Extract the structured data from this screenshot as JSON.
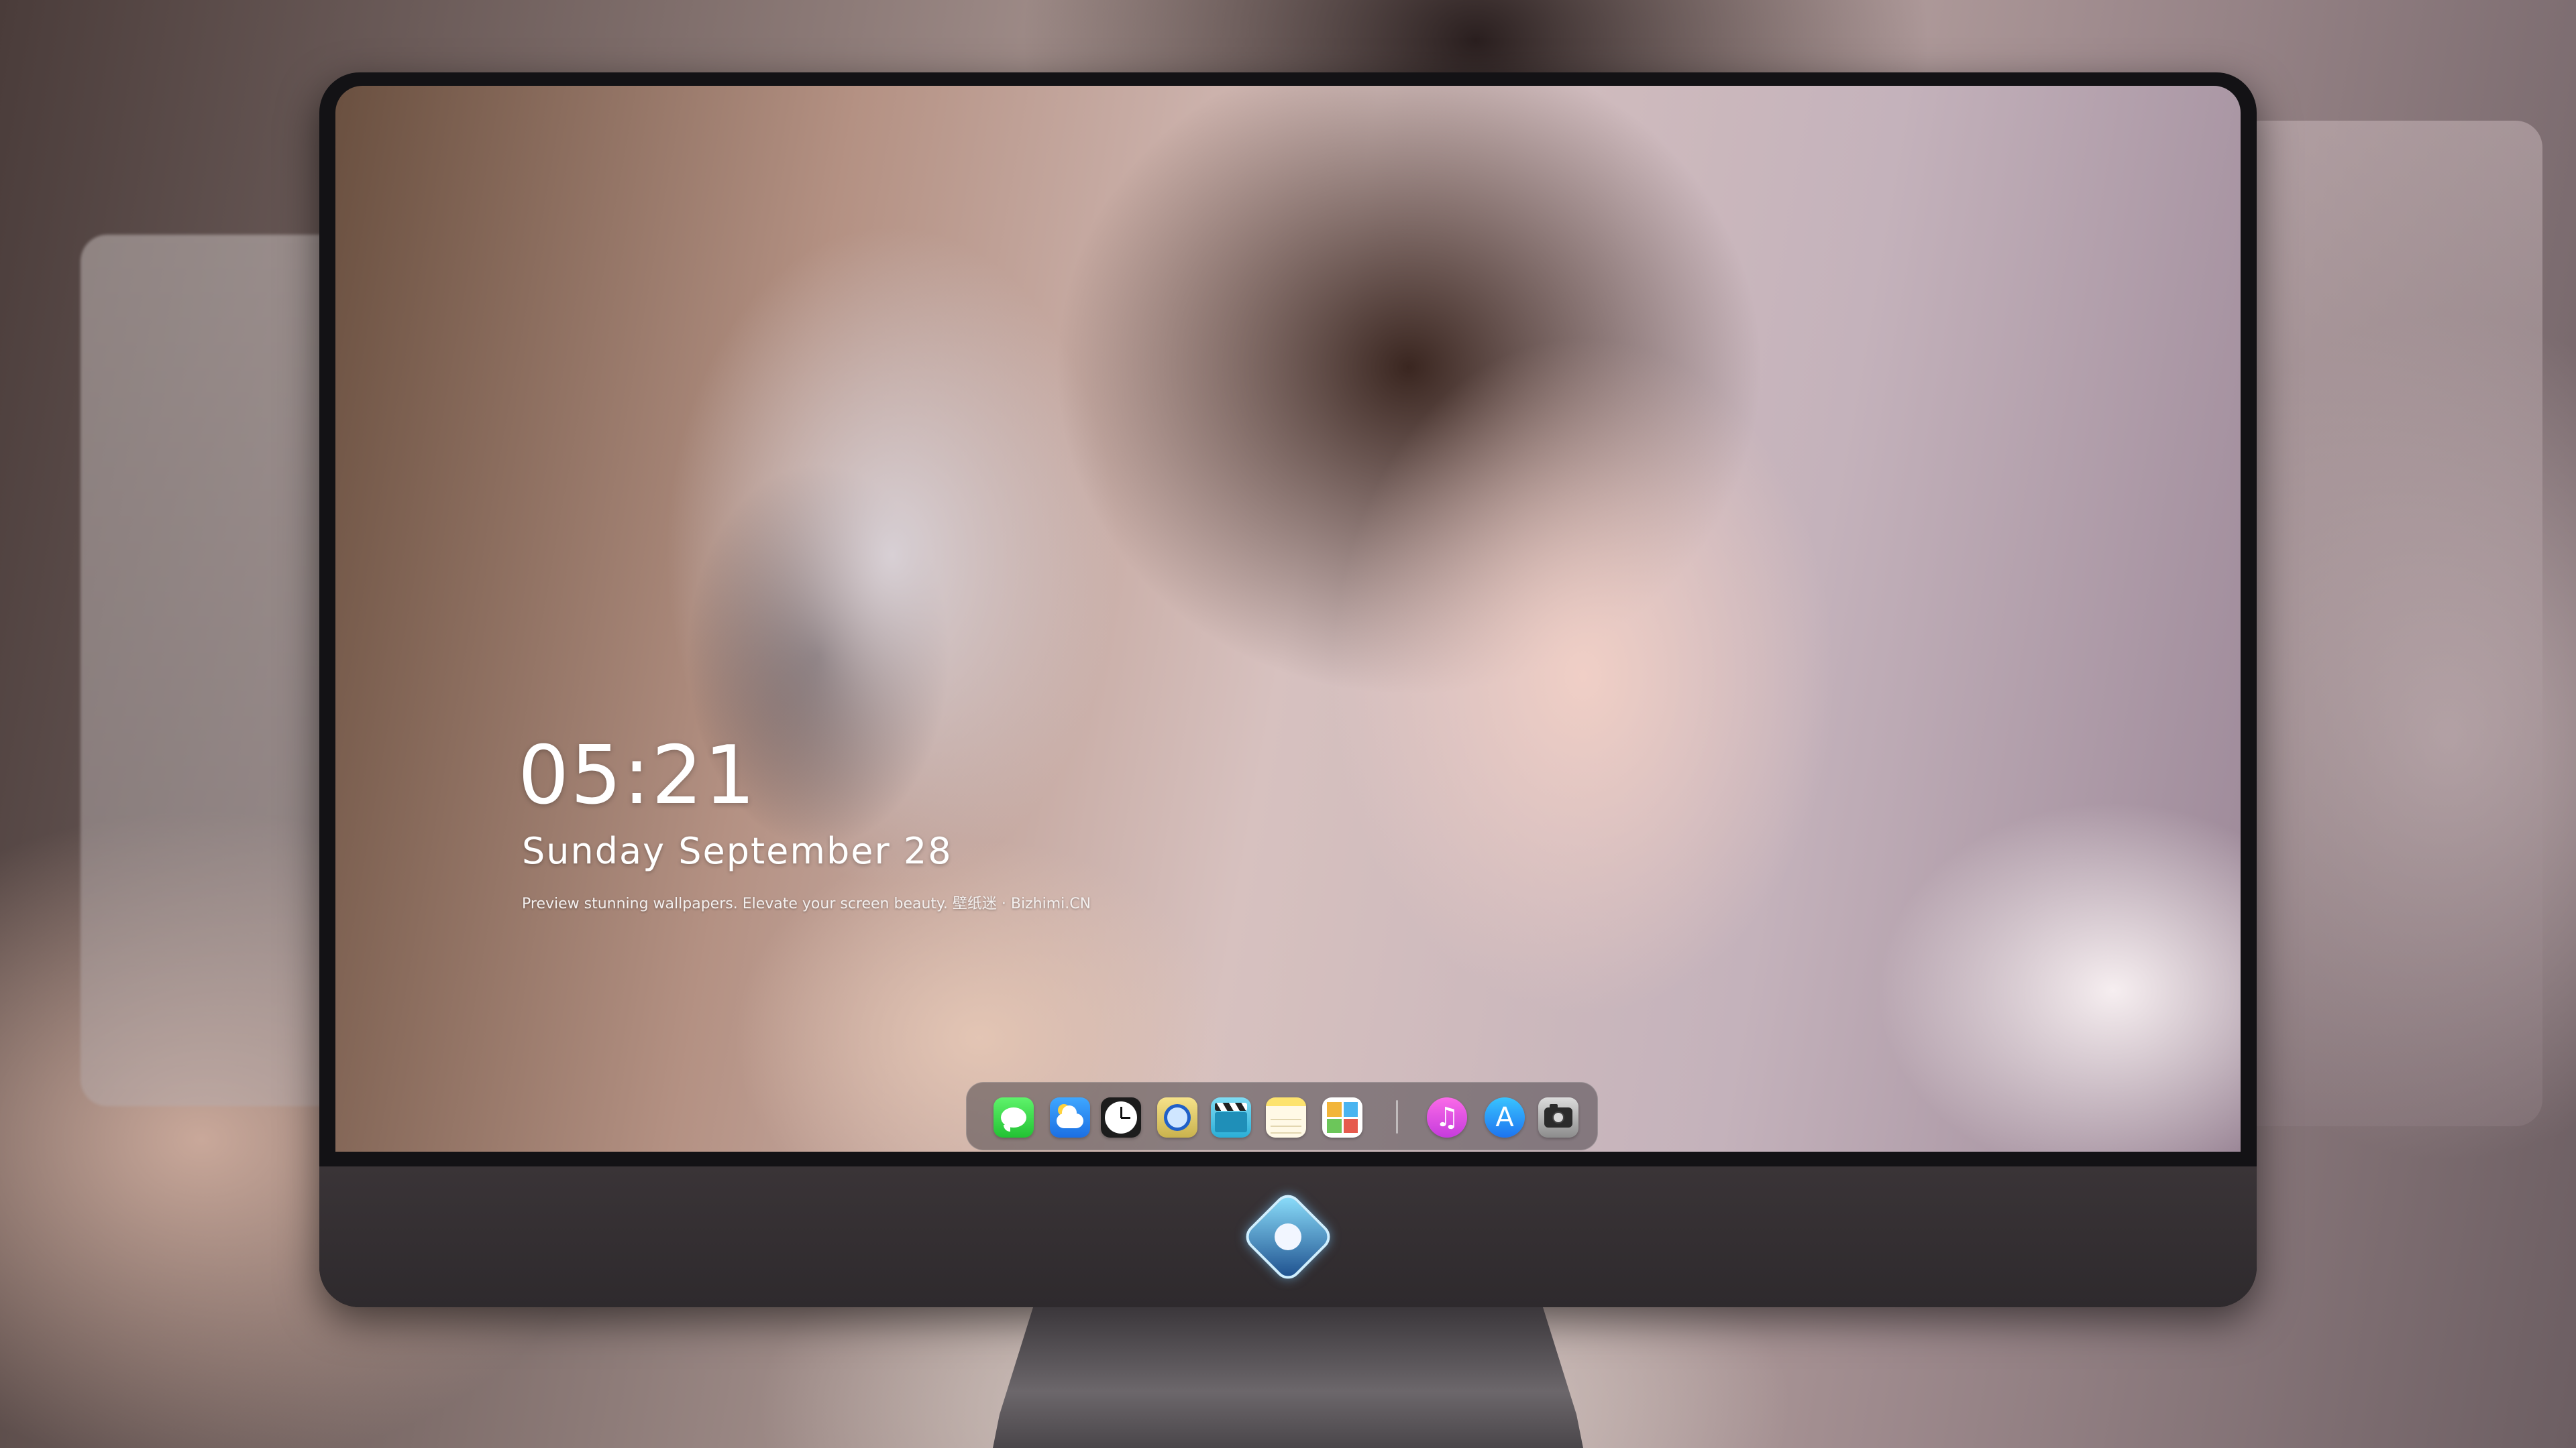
{
  "lockscreen": {
    "time": "05:21",
    "date": "Sunday September  28",
    "caption": "Preview stunning wallpapers. Elevate your screen beauty. 壁纸迷 · Bizhimi.CN"
  },
  "dock": {
    "items": [
      {
        "name": "messages",
        "icon": "messages-icon",
        "color": "#2fd13f"
      },
      {
        "name": "weather",
        "icon": "weather-icon",
        "color": "#2a8cf2"
      },
      {
        "name": "clock",
        "icon": "clock-icon",
        "color": "#1c1c1c"
      },
      {
        "name": "preview",
        "icon": "preview-icon",
        "color": "#e6cf6a"
      },
      {
        "name": "clapper",
        "icon": "clapper-icon",
        "color": "#3cbde3"
      },
      {
        "name": "notes",
        "icon": "notes-icon",
        "color": "#fde36e"
      },
      {
        "name": "photo-gallery",
        "icon": "photo-gallery-icon",
        "color": "#ffffff"
      },
      {
        "name": "music",
        "icon": "music-icon",
        "color": "#e354e3"
      },
      {
        "name": "app-store",
        "icon": "app-store-icon",
        "color": "#2a9cf8"
      },
      {
        "name": "camera",
        "icon": "camera-icon",
        "color": "#9a9a9a"
      }
    ],
    "music_glyph": "♫",
    "appstore_glyph": "A"
  },
  "monitor": {
    "logo": "mascot-logo-icon",
    "bezel_color": "#131215",
    "chin_color": "#35302f"
  }
}
